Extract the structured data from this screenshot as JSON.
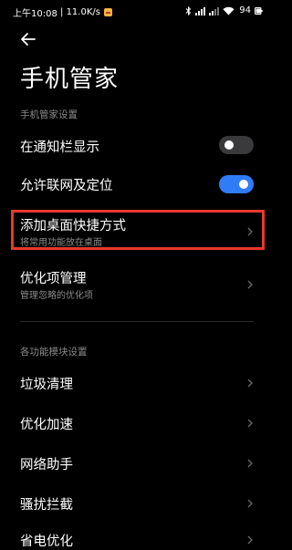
{
  "status_bar": {
    "time": "上午10:08",
    "speed": "11.0K/s",
    "battery": "94"
  },
  "header": {
    "title": "手机管家"
  },
  "sections": {
    "settings_header": "手机管家设置",
    "modules_header": "各功能模块设置"
  },
  "settings": {
    "notification_bar": {
      "label": "在通知栏显示",
      "enabled": false
    },
    "network_location": {
      "label": "允许联网及定位",
      "enabled": true
    },
    "desktop_shortcut": {
      "label": "添加桌面快捷方式",
      "sub": "将常用功能放在桌面"
    },
    "optimization": {
      "label": "优化项管理",
      "sub": "管理忽略的优化项"
    }
  },
  "modules": [
    {
      "label": "垃圾清理"
    },
    {
      "label": "优化加速"
    },
    {
      "label": "网络助手"
    },
    {
      "label": "骚扰拦截"
    },
    {
      "label": "省电优化"
    }
  ],
  "colors": {
    "accent_blue": "#2f7cf6",
    "highlight_red": "#e8382c",
    "secondary_text": "#8a8a8a"
  }
}
